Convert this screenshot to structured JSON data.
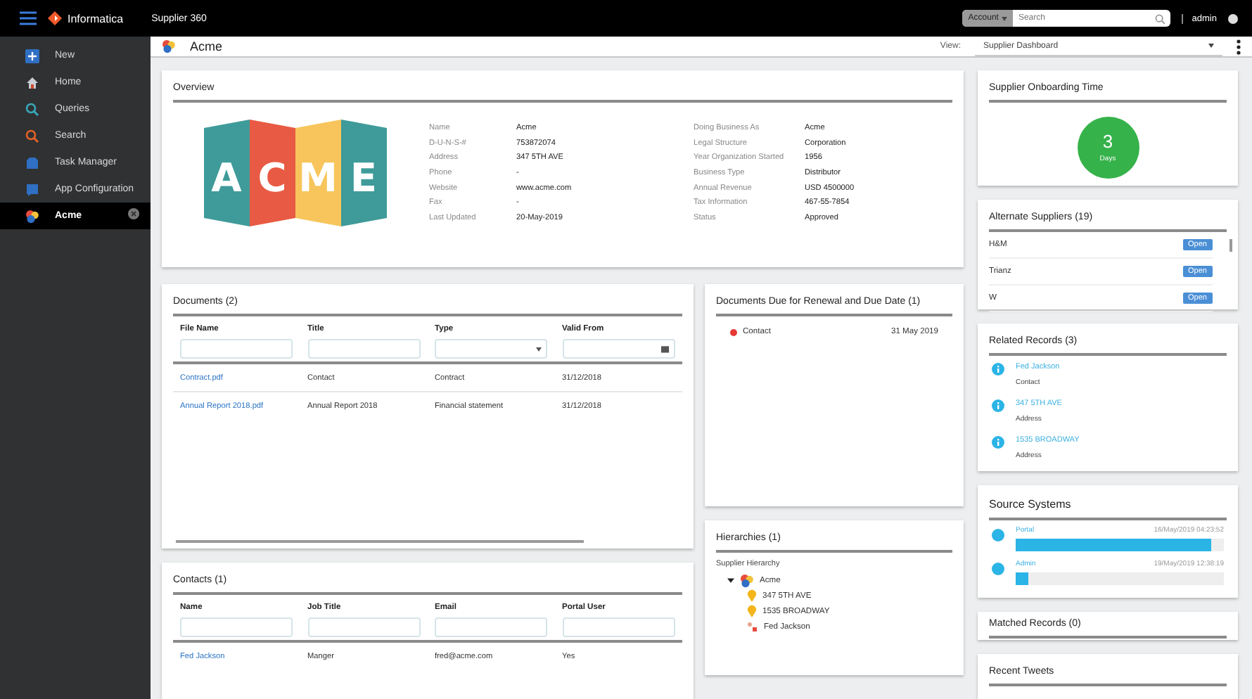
{
  "top_bar": {
    "app_name": "Informatica",
    "product": "Supplier 360",
    "search_scope": "Account",
    "search_placeholder": "Search",
    "user": "admin"
  },
  "sidebar": {
    "items": [
      {
        "label": "New",
        "kind": "new",
        "selected": false,
        "closable": false
      },
      {
        "label": "Home",
        "kind": "home",
        "selected": false,
        "closable": false
      },
      {
        "label": "Queries",
        "kind": "queries",
        "selected": false,
        "closable": false
      },
      {
        "label": "Search",
        "kind": "search",
        "selected": false,
        "closable": false
      },
      {
        "label": "Task Manager",
        "kind": "tasks",
        "selected": false,
        "closable": false
      },
      {
        "label": "App Configuration",
        "kind": "config",
        "selected": false,
        "closable": false
      },
      {
        "label": "Acme",
        "kind": "record",
        "selected": true,
        "closable": true
      }
    ]
  },
  "header": {
    "title": "Acme",
    "view_label": "View:",
    "view_value": "Supplier Dashboard"
  },
  "overview": {
    "title": "Overview",
    "logo_letters": [
      "A",
      "C",
      "M",
      "E"
    ],
    "left_fields": [
      {
        "label": "Name",
        "value": "Acme"
      },
      {
        "label": "D-U-N-S-#",
        "value": "753872074"
      },
      {
        "label": "Address",
        "value": "347 5TH AVE"
      },
      {
        "label": "Phone",
        "value": "-"
      },
      {
        "label": "Website",
        "value": "www.acme.com"
      },
      {
        "label": "Fax",
        "value": "-"
      },
      {
        "label": "Last Updated",
        "value": "20-May-2019"
      }
    ],
    "right_fields": [
      {
        "label": "Doing Business As",
        "value": "Acme"
      },
      {
        "label": "Legal Structure",
        "value": "Corporation"
      },
      {
        "label": "Year Organization Started",
        "value": "1956"
      },
      {
        "label": "Business Type",
        "value": "Distributor"
      },
      {
        "label": "Annual Revenue",
        "value": "USD 4500000"
      },
      {
        "label": "Tax Information",
        "value": "467-55-7854"
      },
      {
        "label": "Status",
        "value": "Approved"
      }
    ]
  },
  "documents": {
    "title": "Documents (2)",
    "columns": [
      {
        "label": "File Name",
        "kind": "text"
      },
      {
        "label": "Title",
        "kind": "text"
      },
      {
        "label": "Type",
        "kind": "select"
      },
      {
        "label": "Valid From",
        "kind": "date"
      }
    ],
    "rows": [
      [
        "Contract.pdf",
        "Contact",
        "Contract",
        "31/12/2018"
      ],
      [
        "Annual Report 2018.pdf",
        "Annual Report 2018",
        "Financial statement",
        "31/12/2018"
      ]
    ]
  },
  "due_documents": {
    "title": "Documents Due for Renewal and Due Date (1)",
    "items": [
      {
        "name": "Contact",
        "date": "31 May 2019"
      }
    ]
  },
  "contacts": {
    "title": "Contacts (1)",
    "columns": [
      {
        "label": "Name",
        "kind": "text"
      },
      {
        "label": "Job Title",
        "kind": "text"
      },
      {
        "label": "Email",
        "kind": "text"
      },
      {
        "label": "Portal User",
        "kind": "text"
      }
    ],
    "rows": [
      [
        "Fed Jackson",
        "Manger",
        "fred@acme.com",
        "Yes"
      ]
    ]
  },
  "hierarchies": {
    "title": "Hierarchies (1)",
    "hierarchy_name": "Supplier Hierarchy",
    "tree": [
      {
        "label": "Acme",
        "kind": "organization",
        "expanded": true,
        "children": [
          {
            "label": "347 5TH AVE",
            "kind": "address"
          },
          {
            "label": "1535 BROADWAY",
            "kind": "address"
          },
          {
            "label": "Fed Jackson",
            "kind": "person"
          }
        ]
      }
    ]
  },
  "onboarding": {
    "title": "Supplier Onboarding Time",
    "value": "3",
    "unit": "Days"
  },
  "alternate_suppliers": {
    "title": "Alternate Suppliers (19)",
    "items": [
      {
        "name": "H&M",
        "action": "Open"
      },
      {
        "name": "Trianz",
        "action": "Open"
      },
      {
        "name": "W",
        "action": "Open"
      }
    ]
  },
  "related_records": {
    "title": "Related Records (3)",
    "items": [
      {
        "name": "Fed Jackson",
        "type": "Contact"
      },
      {
        "name": "347 5TH AVE",
        "type": "Address"
      },
      {
        "name": "1535 BROADWAY",
        "type": "Address"
      }
    ]
  },
  "source_systems": {
    "title": "Source Systems",
    "items": [
      {
        "name": "Portal",
        "timestamp": "16/May/2019 04:23:52",
        "level": 0.94
      },
      {
        "name": "Admin",
        "timestamp": "19/May/2019 12:38:19",
        "level": 0.06
      }
    ]
  },
  "matched_records": {
    "title": "Matched Records (0)"
  },
  "recent_tweets": {
    "title": "Recent Tweets"
  }
}
